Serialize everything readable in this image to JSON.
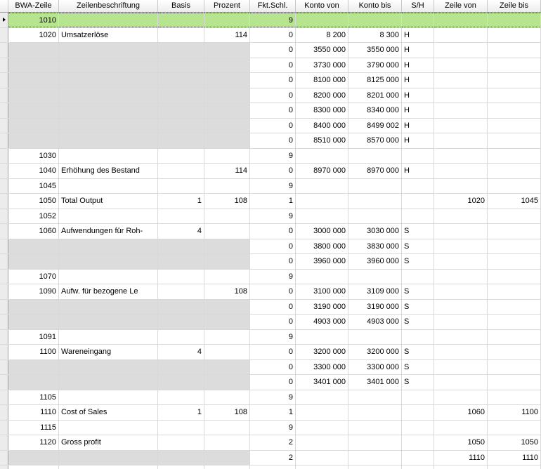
{
  "columns": [
    "BWA-Zeile",
    "Zeilenbeschriftung",
    "Basis",
    "Prozent",
    "Fkt.Schl.",
    "Konto von",
    "Konto bis",
    "S/H",
    "Zeile von",
    "Zeile bis"
  ],
  "rows": [
    {
      "bwa": "1010",
      "label": "",
      "basis": "",
      "prozent": "",
      "fkt": "9",
      "von": "",
      "bis": "",
      "sh": "",
      "zvon": "",
      "zbis": "",
      "kind": "selected"
    },
    {
      "bwa": "1020",
      "label": "Umsatzerlöse",
      "basis": "",
      "prozent": "114",
      "fkt": "0",
      "von": "8 200",
      "bis": "8 300",
      "sh": "H",
      "zvon": "",
      "zbis": "",
      "kind": "main"
    },
    {
      "bwa": "",
      "label": "",
      "basis": "",
      "prozent": "",
      "fkt": "0",
      "von": "3550 000",
      "bis": "3550 000",
      "sh": "H",
      "zvon": "",
      "zbis": "",
      "kind": "sub"
    },
    {
      "bwa": "",
      "label": "",
      "basis": "",
      "prozent": "",
      "fkt": "0",
      "von": "3730 000",
      "bis": "3790 000",
      "sh": "H",
      "zvon": "",
      "zbis": "",
      "kind": "sub"
    },
    {
      "bwa": "",
      "label": "",
      "basis": "",
      "prozent": "",
      "fkt": "0",
      "von": "8100 000",
      "bis": "8125 000",
      "sh": "H",
      "zvon": "",
      "zbis": "",
      "kind": "sub"
    },
    {
      "bwa": "",
      "label": "",
      "basis": "",
      "prozent": "",
      "fkt": "0",
      "von": "8200 000",
      "bis": "8201 000",
      "sh": "H",
      "zvon": "",
      "zbis": "",
      "kind": "sub"
    },
    {
      "bwa": "",
      "label": "",
      "basis": "",
      "prozent": "",
      "fkt": "0",
      "von": "8300 000",
      "bis": "8340 000",
      "sh": "H",
      "zvon": "",
      "zbis": "",
      "kind": "sub"
    },
    {
      "bwa": "",
      "label": "",
      "basis": "",
      "prozent": "",
      "fkt": "0",
      "von": "8400 000",
      "bis": "8499 002",
      "sh": "H",
      "zvon": "",
      "zbis": "",
      "kind": "sub"
    },
    {
      "bwa": "",
      "label": "",
      "basis": "",
      "prozent": "",
      "fkt": "0",
      "von": "8510 000",
      "bis": "8570 000",
      "sh": "H",
      "zvon": "",
      "zbis": "",
      "kind": "sub"
    },
    {
      "bwa": "1030",
      "label": "",
      "basis": "",
      "prozent": "",
      "fkt": "9",
      "von": "",
      "bis": "",
      "sh": "",
      "zvon": "",
      "zbis": "",
      "kind": "main"
    },
    {
      "bwa": "1040",
      "label": "Erhöhung des Bestand",
      "basis": "",
      "prozent": "114",
      "fkt": "0",
      "von": "8970 000",
      "bis": "8970 000",
      "sh": "H",
      "zvon": "",
      "zbis": "",
      "kind": "main"
    },
    {
      "bwa": "1045",
      "label": "",
      "basis": "",
      "prozent": "",
      "fkt": "9",
      "von": "",
      "bis": "",
      "sh": "",
      "zvon": "",
      "zbis": "",
      "kind": "main"
    },
    {
      "bwa": "1050",
      "label": "Total Output",
      "basis": "1",
      "prozent": "108",
      "fkt": "1",
      "von": "",
      "bis": "",
      "sh": "",
      "zvon": "1020",
      "zbis": "1045",
      "kind": "main"
    },
    {
      "bwa": "1052",
      "label": "",
      "basis": "",
      "prozent": "",
      "fkt": "9",
      "von": "",
      "bis": "",
      "sh": "",
      "zvon": "",
      "zbis": "",
      "kind": "main"
    },
    {
      "bwa": "1060",
      "label": "Aufwendungen für Roh-",
      "basis": "4",
      "prozent": "",
      "fkt": "0",
      "von": "3000 000",
      "bis": "3030 000",
      "sh": "S",
      "zvon": "",
      "zbis": "",
      "kind": "main"
    },
    {
      "bwa": "",
      "label": "",
      "basis": "",
      "prozent": "",
      "fkt": "0",
      "von": "3800 000",
      "bis": "3830 000",
      "sh": "S",
      "zvon": "",
      "zbis": "",
      "kind": "sub"
    },
    {
      "bwa": "",
      "label": "",
      "basis": "",
      "prozent": "",
      "fkt": "0",
      "von": "3960 000",
      "bis": "3960 000",
      "sh": "S",
      "zvon": "",
      "zbis": "",
      "kind": "sub"
    },
    {
      "bwa": "1070",
      "label": "",
      "basis": "",
      "prozent": "",
      "fkt": "9",
      "von": "",
      "bis": "",
      "sh": "",
      "zvon": "",
      "zbis": "",
      "kind": "main"
    },
    {
      "bwa": "1090",
      "label": "Aufw. für bezogene Le",
      "basis": "",
      "prozent": "108",
      "fkt": "0",
      "von": "3100 000",
      "bis": "3109 000",
      "sh": "S",
      "zvon": "",
      "zbis": "",
      "kind": "main"
    },
    {
      "bwa": "",
      "label": "",
      "basis": "",
      "prozent": "",
      "fkt": "0",
      "von": "3190 000",
      "bis": "3190 000",
      "sh": "S",
      "zvon": "",
      "zbis": "",
      "kind": "sub"
    },
    {
      "bwa": "",
      "label": "",
      "basis": "",
      "prozent": "",
      "fkt": "0",
      "von": "4903 000",
      "bis": "4903 000",
      "sh": "S",
      "zvon": "",
      "zbis": "",
      "kind": "sub"
    },
    {
      "bwa": "1091",
      "label": "",
      "basis": "",
      "prozent": "",
      "fkt": "9",
      "von": "",
      "bis": "",
      "sh": "",
      "zvon": "",
      "zbis": "",
      "kind": "main"
    },
    {
      "bwa": "1100",
      "label": "Wareneingang",
      "basis": "4",
      "prozent": "",
      "fkt": "0",
      "von": "3200 000",
      "bis": "3200 000",
      "sh": "S",
      "zvon": "",
      "zbis": "",
      "kind": "main"
    },
    {
      "bwa": "",
      "label": "",
      "basis": "",
      "prozent": "",
      "fkt": "0",
      "von": "3300 000",
      "bis": "3300 000",
      "sh": "S",
      "zvon": "",
      "zbis": "",
      "kind": "sub"
    },
    {
      "bwa": "",
      "label": "",
      "basis": "",
      "prozent": "",
      "fkt": "0",
      "von": "3401 000",
      "bis": "3401 000",
      "sh": "S",
      "zvon": "",
      "zbis": "",
      "kind": "sub"
    },
    {
      "bwa": "1105",
      "label": "",
      "basis": "",
      "prozent": "",
      "fkt": "9",
      "von": "",
      "bis": "",
      "sh": "",
      "zvon": "",
      "zbis": "",
      "kind": "main"
    },
    {
      "bwa": "1110",
      "label": "Cost of Sales",
      "basis": "1",
      "prozent": "108",
      "fkt": "1",
      "von": "",
      "bis": "",
      "sh": "",
      "zvon": "1060",
      "zbis": "1100",
      "kind": "main"
    },
    {
      "bwa": "1115",
      "label": "",
      "basis": "",
      "prozent": "",
      "fkt": "9",
      "von": "",
      "bis": "",
      "sh": "",
      "zvon": "",
      "zbis": "",
      "kind": "main"
    },
    {
      "bwa": "1120",
      "label": "Gross profit",
      "basis": "",
      "prozent": "",
      "fkt": "2",
      "von": "",
      "bis": "",
      "sh": "",
      "zvon": "1050",
      "zbis": "1050",
      "kind": "main"
    },
    {
      "bwa": "",
      "label": "",
      "basis": "",
      "prozent": "",
      "fkt": "2",
      "von": "",
      "bis": "",
      "sh": "",
      "zvon": "1110",
      "zbis": "1110",
      "kind": "sub"
    },
    {
      "bwa": "",
      "label": "",
      "basis": "",
      "prozent": "",
      "fkt": "",
      "von": "",
      "bis": "",
      "sh": "",
      "zvon": "",
      "zbis": "",
      "kind": "main"
    }
  ]
}
